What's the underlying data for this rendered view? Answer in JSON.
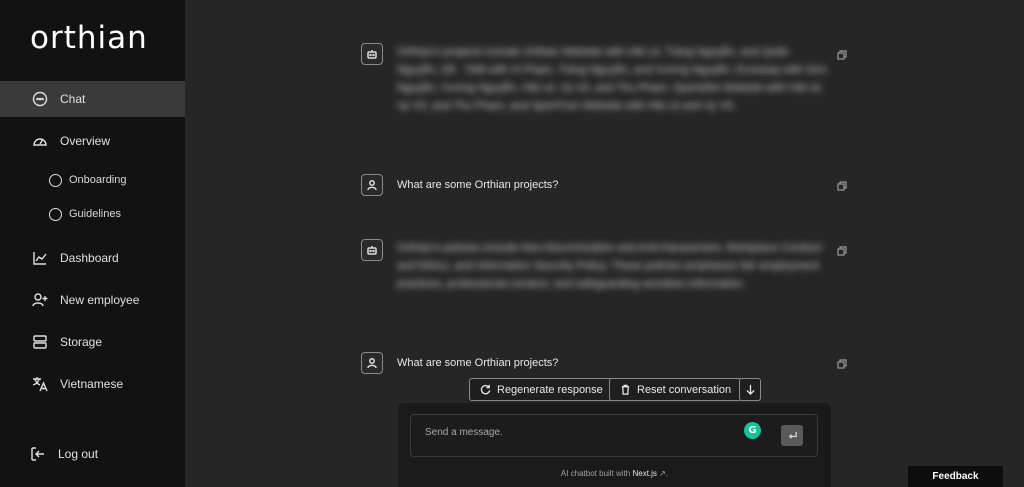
{
  "app": {
    "logo": "orthian"
  },
  "sidebar": {
    "items": [
      {
        "label": "Chat",
        "icon": "chat-bubble-icon",
        "active": true
      },
      {
        "label": "Overview",
        "icon": "gauge-icon"
      },
      {
        "label": "Onboarding",
        "icon": "circle-icon"
      },
      {
        "label": "Guidelines",
        "icon": "circle-icon"
      },
      {
        "label": "Dashboard",
        "icon": "line-chart-icon"
      },
      {
        "label": "New employee",
        "icon": "user-plus-icon"
      },
      {
        "label": "Storage",
        "icon": "storage-icon"
      },
      {
        "label": "Vietnamese",
        "icon": "language-icon"
      }
    ],
    "logout": "Log out"
  },
  "messages": [
    {
      "role": "bot",
      "text": "Orthian's projects include Orthian Website with Hải Lê, Tráng Nguyễn, and Quân Nguyễn, Zili - TAB with Vi Phạm, Tráng Nguyễn, and Vương Nguyễn, Ecosway with Sơn Nguyễn, Vương Nguyễn, Hải Lê, Vy Vũ, and Thu Phạm, Sportsfire Website with Hải Lê, Vy Vũ, and Thu Phạm, and SportTum Website with Hải Lê and Vy Vũ.",
      "blurred": true
    },
    {
      "role": "user",
      "text": "What are some Orthian projects?",
      "blurred": false
    },
    {
      "role": "bot",
      "text": "Orthian's policies include Non-Discrimination and Anti-Harassment, Workplace Conduct and Ethics, and Information Security Policy. These policies emphasize fair employment practices, professional conduct, and safeguarding sensitive information.",
      "blurred": true
    },
    {
      "role": "user",
      "text": "What are some Orthian projects?",
      "blurred": false
    }
  ],
  "actions": {
    "regenerate": "Regenerate response",
    "reset": "Reset conversation"
  },
  "composer": {
    "placeholder": "Send a message.",
    "grammarly_badge": "G",
    "footer_prefix": "AI chatbot built with",
    "footer_link": "Next.js",
    "footer_suffix": "↗."
  },
  "feedback": "Feedback"
}
